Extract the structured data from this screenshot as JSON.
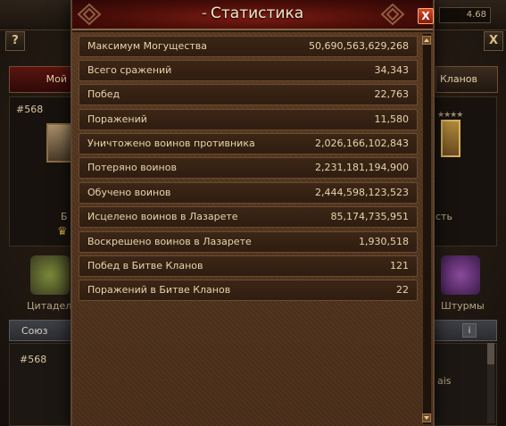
{
  "background": {
    "counter_text": "4.68",
    "help_label": "?",
    "close_label": "X",
    "tab_my_label": "Мой",
    "tab_clans_label": "Кланов",
    "player_id": "#568",
    "left_text_1": "Б",
    "right_text_1": "сть",
    "citadel_label": "Цитадель",
    "storms_label": "Штурмы",
    "alliance_label": "Союз",
    "alliance_info_label": "i",
    "list_id": "#568",
    "list_right_text": "ais"
  },
  "modal": {
    "title": "Статистика",
    "close_label": "X",
    "stats": [
      {
        "label": "Максимум Могущества",
        "value": "50,690,563,629,268"
      },
      {
        "label": "Всего сражений",
        "value": "34,343"
      },
      {
        "label": "Побед",
        "value": "22,763"
      },
      {
        "label": "Поражений",
        "value": "11,580"
      },
      {
        "label": "Уничтожено воинов противника",
        "value": "2,026,166,102,843"
      },
      {
        "label": "Потеряно воинов",
        "value": "2,231,181,194,900"
      },
      {
        "label": "Обучено воинов",
        "value": "2,444,598,123,523"
      },
      {
        "label": "Исцелено воинов в Лазарете",
        "value": "85,174,735,951"
      },
      {
        "label": "Воскрешено воинов в Лазарете",
        "value": "1,930,518"
      },
      {
        "label": "Побед в Битве Кланов",
        "value": "121"
      },
      {
        "label": "Поражений в Битве Кланов",
        "value": "22"
      }
    ]
  },
  "colors": {
    "header_red": "#7a1c14",
    "row_text": "#e6d5ad",
    "body_brown": "#5a3a22"
  }
}
